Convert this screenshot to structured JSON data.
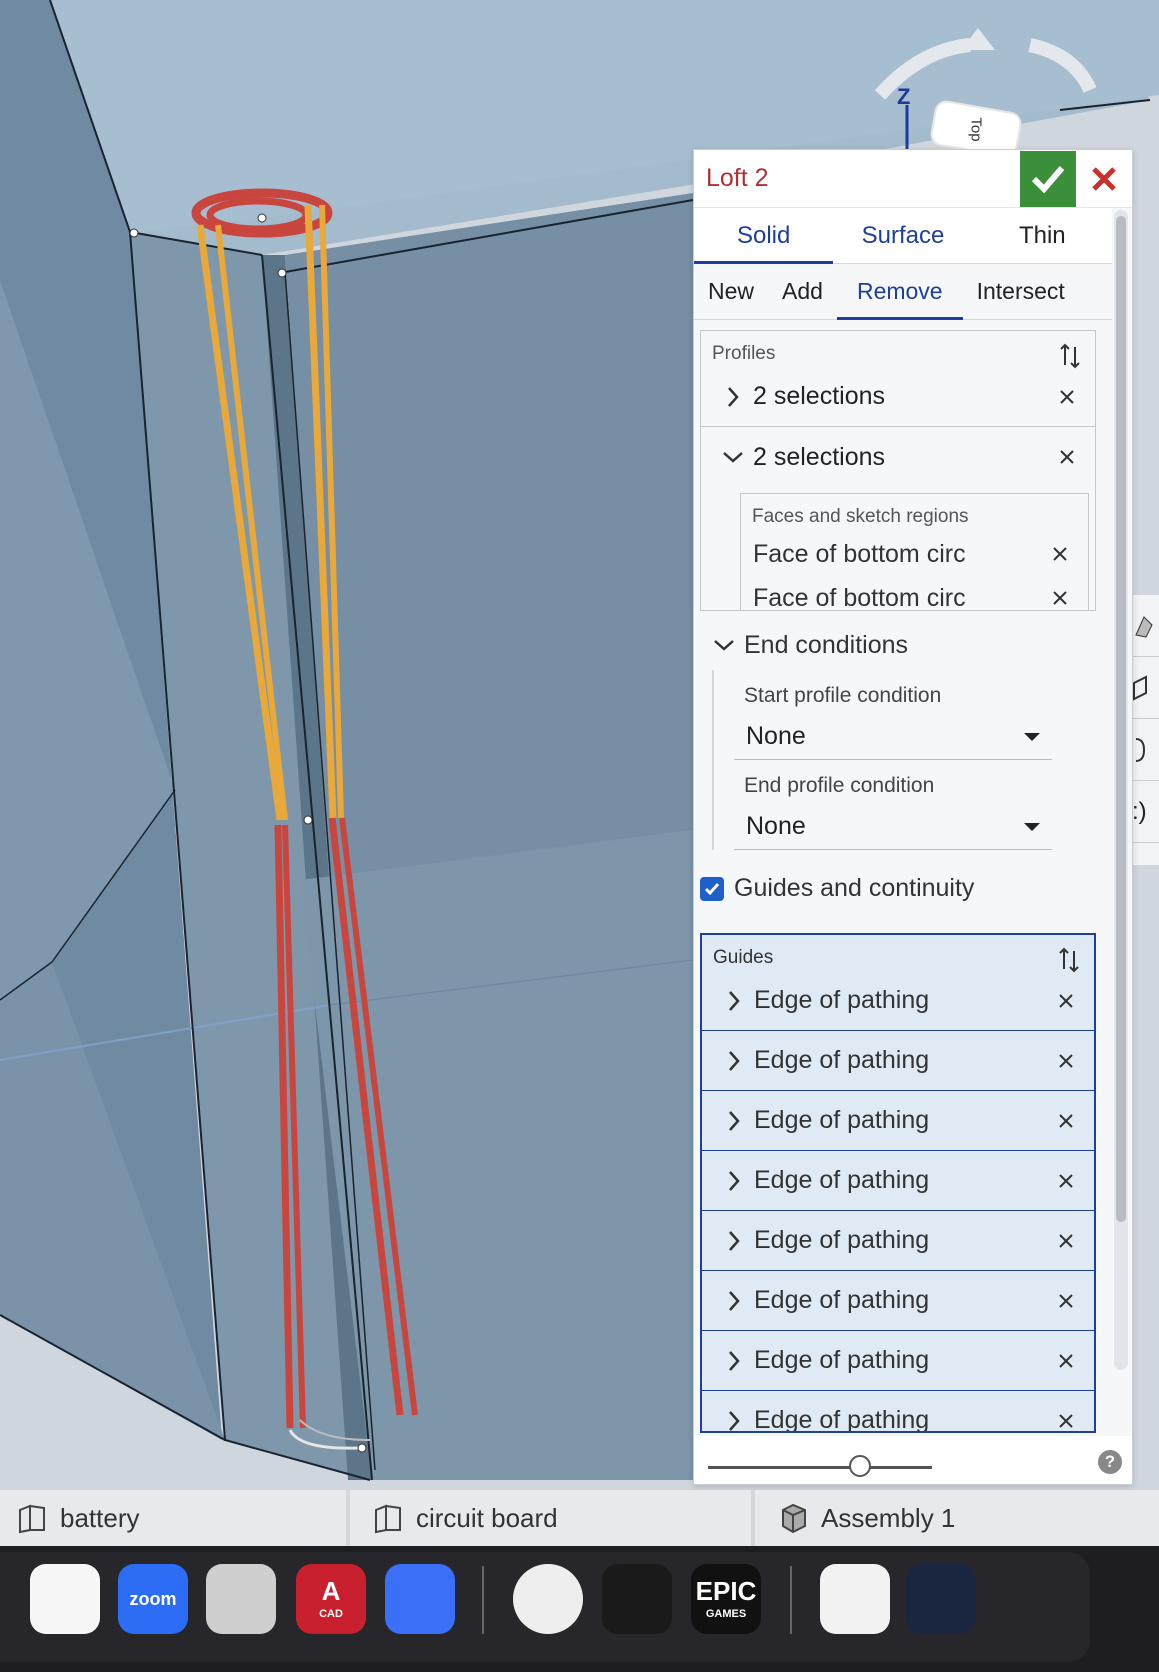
{
  "viewport": {
    "view_cube_axis": "Z",
    "view_cube_face": "Top"
  },
  "loft": {
    "title": "Loft 2",
    "tabs": [
      {
        "label": "Solid",
        "active": true
      },
      {
        "label": "Surface",
        "active": false
      },
      {
        "label": "Thin",
        "active": false
      }
    ],
    "operations": [
      {
        "label": "New",
        "active": false
      },
      {
        "label": "Add",
        "active": false
      },
      {
        "label": "Remove",
        "active": true
      },
      {
        "label": "Intersect",
        "active": false
      }
    ],
    "profiles": {
      "label": "Profiles",
      "rows": [
        {
          "label": "2 selections",
          "expanded": false
        },
        {
          "label": "2 selections",
          "expanded": true
        }
      ],
      "faces_label": "Faces and sketch regions",
      "faces": [
        "Face of bottom circ",
        "Face of bottom circ"
      ]
    },
    "end_conditions": {
      "label": "End conditions",
      "start_label": "Start profile condition",
      "start_value": "None",
      "end_label": "End profile condition",
      "end_value": "None"
    },
    "guides_checkbox": {
      "label": "Guides and continuity",
      "checked": true
    },
    "guides": {
      "label": "Guides",
      "items": [
        "Edge of pathing",
        "Edge of pathing",
        "Edge of pathing",
        "Edge of pathing",
        "Edge of pathing",
        "Edge of pathing",
        "Edge of pathing",
        "Edge of pathing"
      ]
    },
    "slider_value": 0.68,
    "help": "?"
  },
  "right_toolbar": [
    ":)"
  ],
  "document_tabs": [
    {
      "label": "battery",
      "icon": "part-studio-icon"
    },
    {
      "label": "circuit board",
      "icon": "part-studio-icon"
    },
    {
      "label": "Assembly 1",
      "icon": "assembly-icon"
    }
  ],
  "dock": {
    "apps": [
      {
        "name": "news-app-icon",
        "color": "#f7f7f7"
      },
      {
        "name": "zoom-app-icon",
        "label": "zoom",
        "color": "#2d6cf5"
      },
      {
        "name": "iphone-mirroring-app-icon",
        "color": "#cfcfcf"
      },
      {
        "name": "autocad-app-icon",
        "label": "A",
        "sublabel": "CAD",
        "color": "#c8202f"
      },
      {
        "name": "roblox-app-icon",
        "color": "#3b6ff7"
      },
      {
        "name": "krita-app-icon",
        "color": "#eeeeee"
      },
      {
        "name": "onshape-night-app-icon",
        "color": "#1a1a1a"
      },
      {
        "name": "epic-games-app-icon",
        "label": "EPIC",
        "sublabel": "GAMES",
        "color": "#111111"
      },
      {
        "name": "document-file-icon",
        "color": "#f2f2f2"
      },
      {
        "name": "firefox-window-thumbnail",
        "color": "#1a2540"
      },
      {
        "name": "trash-icon",
        "color": "#888888"
      }
    ]
  },
  "colors": {
    "accent": "#1f3f9c",
    "title_red": "#b23234",
    "accept_green": "#3c8f3a",
    "guide_bg": "#dfeaf5",
    "edge_orange": "#e8a83a",
    "edge_red": "#c9463e"
  }
}
